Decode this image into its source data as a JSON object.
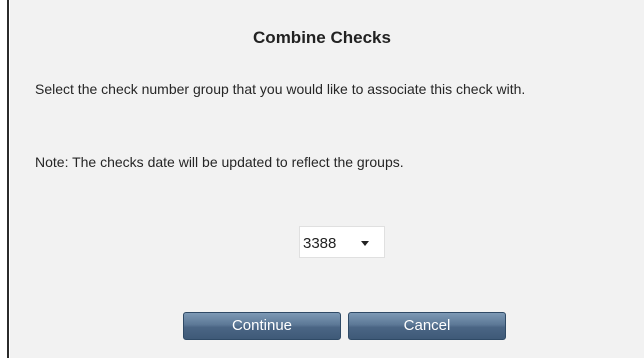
{
  "dialog": {
    "title": "Combine Checks",
    "instruction": "Select the check number group that you would like to associate this check with.",
    "note": "Note: The checks date will be updated to reflect the groups."
  },
  "select": {
    "selected_value": "3388",
    "icon": "chevron-down-icon"
  },
  "buttons": {
    "continue_label": "Continue",
    "cancel_label": "Cancel"
  },
  "colors": {
    "dialog_background": "#f2f2f2",
    "button_background": "#4a6584",
    "button_text": "#ffffff"
  }
}
